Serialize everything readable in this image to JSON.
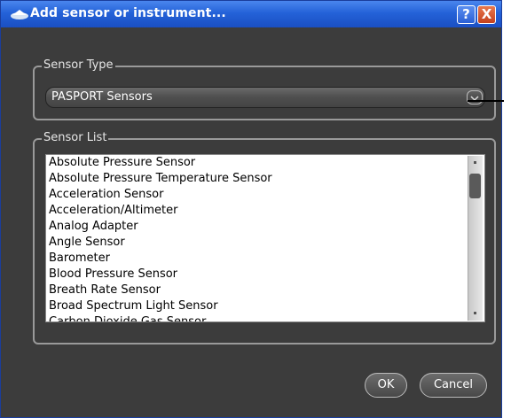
{
  "window": {
    "title": "Add sensor or instrument...",
    "help_label": "?",
    "close_label": "X"
  },
  "sensor_type": {
    "legend": "Sensor Type",
    "selected": "PASPORT Sensors"
  },
  "sensor_list": {
    "legend": "Sensor List",
    "items": [
      "Absolute Pressure Sensor",
      "Absolute Pressure Temperature Sensor",
      "Acceleration Sensor",
      "Acceleration/Altimeter",
      "Analog Adapter",
      "Angle Sensor",
      "Barometer",
      "Blood Pressure Sensor",
      "Breath Rate Sensor",
      "Broad Spectrum Light Sensor",
      "Carbon Dioxide Gas Sensor"
    ]
  },
  "buttons": {
    "ok": "OK",
    "cancel": "Cancel"
  },
  "colors": {
    "titlebar": "#2462d8",
    "dialog_bg": "#3c3c3c",
    "close_button": "#c4401d"
  }
}
